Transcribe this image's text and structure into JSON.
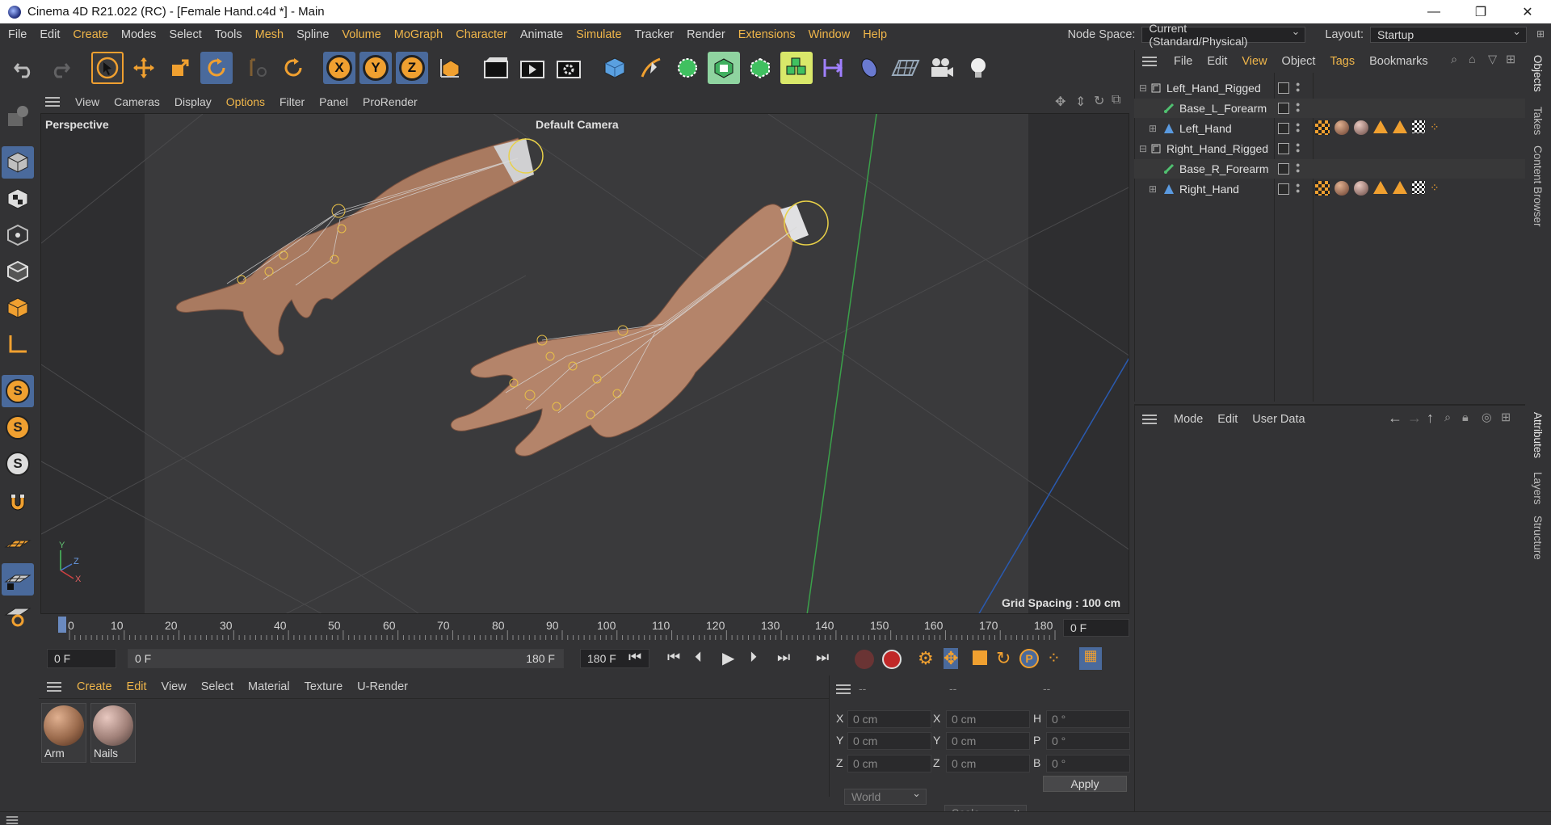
{
  "window": {
    "title": "Cinema 4D R21.022 (RC) - [Female Hand.c4d *] - Main",
    "minimize": "—",
    "maximize": "❐",
    "close": "✕"
  },
  "menubar": {
    "items": [
      "File",
      "Edit",
      "Create",
      "Modes",
      "Select",
      "Tools",
      "Mesh",
      "Spline",
      "Volume",
      "MoGraph",
      "Character",
      "Animate",
      "Simulate",
      "Tracker",
      "Render",
      "Extensions",
      "Window",
      "Help"
    ],
    "accent_items": [
      "Volume",
      "MoGraph",
      "Character",
      "Simulate",
      "Extensions",
      "Window",
      "Help"
    ],
    "node_space_label": "Node Space:",
    "node_space_value": "Current (Standard/Physical)",
    "layout_label": "Layout:",
    "layout_value": "Startup"
  },
  "toolbar": {
    "axis_x": "X",
    "axis_y": "Y",
    "axis_z": "Z"
  },
  "lefttools": {
    "s1": "S",
    "s2": "S",
    "s3": "S"
  },
  "viewport": {
    "menu": [
      "View",
      "Cameras",
      "Display",
      "Options",
      "Filter",
      "Panel",
      "ProRender"
    ],
    "accent_menu": "Options",
    "label": "Perspective",
    "camera": "Default Camera",
    "grid_spacing": "Grid Spacing : 100 cm",
    "axis_labels": {
      "y": "Y",
      "z": "Z",
      "x": "X"
    }
  },
  "timeline": {
    "ticks": [
      "0",
      "10",
      "20",
      "30",
      "40",
      "50",
      "60",
      "70",
      "80",
      "90",
      "100",
      "110",
      "120",
      "130",
      "140",
      "150",
      "160",
      "170",
      "180"
    ],
    "current_frame": "0 F",
    "start_field": "0 F",
    "range_start": "0 F",
    "range_end": "180 F",
    "end_field": "180 F"
  },
  "materials": {
    "menu": [
      "Create",
      "Edit",
      "View",
      "Select",
      "Material",
      "Texture",
      "U-Render"
    ],
    "accent_menu": [
      "Create",
      "Edit"
    ],
    "items": [
      {
        "name": "Arm"
      },
      {
        "name": "Nails"
      }
    ]
  },
  "coordinates": {
    "headers": [
      "--",
      "--",
      "--"
    ],
    "rows": [
      {
        "a": "X",
        "av": "0 cm",
        "b": "X",
        "bv": "0 cm",
        "c": "H",
        "cv": "0 °"
      },
      {
        "a": "Y",
        "av": "0 cm",
        "b": "Y",
        "bv": "0 cm",
        "c": "P",
        "cv": "0 °"
      },
      {
        "a": "Z",
        "av": "0 cm",
        "b": "Z",
        "bv": "0 cm",
        "c": "B",
        "cv": "0 °"
      }
    ],
    "mode_world": "World",
    "mode_scale": "Scale",
    "apply": "Apply"
  },
  "objects": {
    "menu": [
      "File",
      "Edit",
      "View",
      "Object",
      "Tags",
      "Bookmarks"
    ],
    "accent_menu": [
      "View",
      "Tags"
    ],
    "rows": [
      {
        "name": "Left_Hand_Rigged",
        "indent": 0,
        "type": "null",
        "tags": false
      },
      {
        "name": "Base_L_Forearm",
        "indent": 1,
        "type": "bone",
        "tags": false
      },
      {
        "name": "Left_Hand",
        "indent": 1,
        "type": "mesh",
        "tags": true
      },
      {
        "name": "Right_Hand_Rigged",
        "indent": 0,
        "type": "null",
        "tags": false
      },
      {
        "name": "Base_R_Forearm",
        "indent": 1,
        "type": "bone",
        "tags": false
      },
      {
        "name": "Right_Hand",
        "indent": 1,
        "type": "mesh",
        "tags": true
      }
    ]
  },
  "attributes": {
    "menu": [
      "Mode",
      "Edit",
      "User Data"
    ]
  },
  "sidetabs": {
    "top": [
      "Objects",
      "Takes",
      "Content Browser"
    ],
    "bottom": [
      "Attributes",
      "Layers",
      "Structure"
    ]
  },
  "colors": {
    "accent": "#f0b64a",
    "panel_bg": "#333335",
    "active_tool": "#4a6a9c",
    "skin": "#b98a6c"
  }
}
